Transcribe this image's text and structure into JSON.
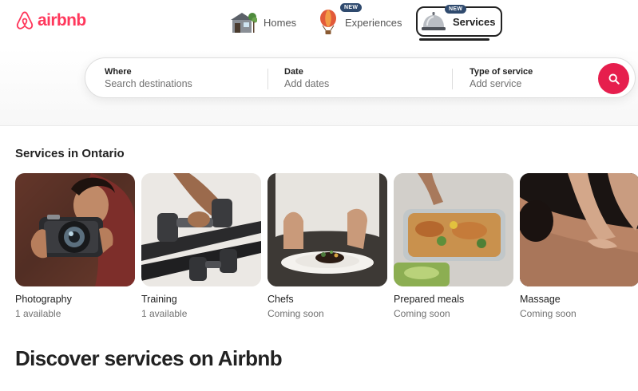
{
  "brand": {
    "name": "airbnb",
    "color": "#ff385c"
  },
  "nav": {
    "homes": {
      "label": "Homes",
      "icon": "house-icon"
    },
    "experiences": {
      "label": "Experiences",
      "badge": "NEW",
      "icon": "hot-air-balloon-icon"
    },
    "services": {
      "label": "Services",
      "badge": "NEW",
      "icon": "service-bell-icon",
      "active": true
    }
  },
  "search": {
    "where": {
      "label": "Where",
      "placeholder": "Search destinations"
    },
    "date": {
      "label": "Date",
      "placeholder": "Add dates"
    },
    "type": {
      "label": "Type of service",
      "placeholder": "Add service"
    },
    "button_icon": "search-icon"
  },
  "section": {
    "title": "Services in Ontario",
    "cards": [
      {
        "title": "Photography",
        "subtitle": "1 available",
        "image": "camera-photo"
      },
      {
        "title": "Training",
        "subtitle": "1 available",
        "image": "dumbbell-photo"
      },
      {
        "title": "Chefs",
        "subtitle": "Coming soon",
        "image": "plated-dish-photo"
      },
      {
        "title": "Prepared meals",
        "subtitle": "Coming soon",
        "image": "meal-container-photo"
      },
      {
        "title": "Massage",
        "subtitle": "Coming soon",
        "image": "massage-photo"
      }
    ]
  },
  "discover": {
    "title": "Discover services on Airbnb"
  }
}
